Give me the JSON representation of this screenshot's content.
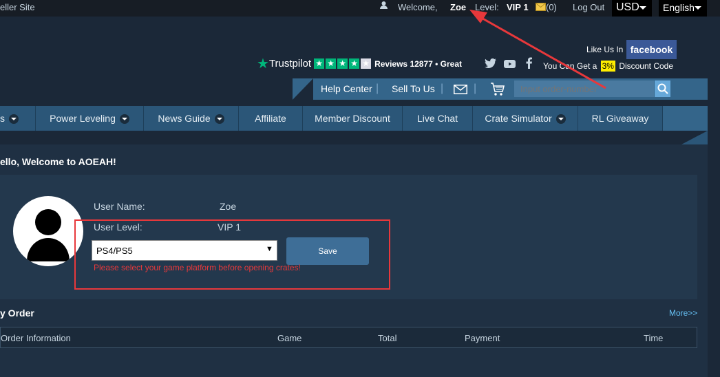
{
  "topbar": {
    "left_link": "eller Site",
    "welcome": "Welcome,",
    "username": "Zoe",
    "level_label": "Level:",
    "level_value": "VIP 1",
    "mail_count": "(0)",
    "logout": "Log Out",
    "currency": "USD",
    "language": "English"
  },
  "header": {
    "trustpilot_label": "Trustpilot",
    "trustpilot_stars": 4,
    "reviews": "Reviews 12877 • Great",
    "like_us": "Like Us In",
    "facebook": "facebook",
    "discount_prefix": "You Can Get a",
    "discount_value": "3%",
    "discount_suffix": "Discount Code"
  },
  "utilbar": {
    "help": "Help Center",
    "sell": "Sell To Us",
    "search_placeholder": "Input order-number"
  },
  "nav": {
    "items": [
      {
        "label": "s",
        "dropdown": true
      },
      {
        "label": "Power Leveling",
        "dropdown": true
      },
      {
        "label": "News Guide",
        "dropdown": true
      },
      {
        "label": "Affiliate",
        "dropdown": false
      },
      {
        "label": "Member Discount",
        "dropdown": false
      },
      {
        "label": "Live Chat",
        "dropdown": false
      },
      {
        "label": "Crate Simulator",
        "dropdown": true
      },
      {
        "label": "RL Giveaway",
        "dropdown": false
      }
    ]
  },
  "welcome_heading": "ello, Welcome to AOEAH!",
  "profile": {
    "username_label": "User Name:",
    "username_value": "Zoe",
    "level_label": "User Level:",
    "level_value": "VIP 1",
    "platform_selected": "PS4/PS5",
    "save_label": "Save",
    "warning": "Please select your game platform before opening crates!"
  },
  "orders": {
    "title": "y Order",
    "more": "More>>",
    "columns": [
      "Order Information",
      "Game",
      "Total",
      "Payment",
      "Time"
    ]
  },
  "colors": {
    "annotation_red": "#e8383b",
    "nav_bg": "#2b5678",
    "accent_blue": "#66c0f4",
    "warning_red": "#e8383b"
  }
}
